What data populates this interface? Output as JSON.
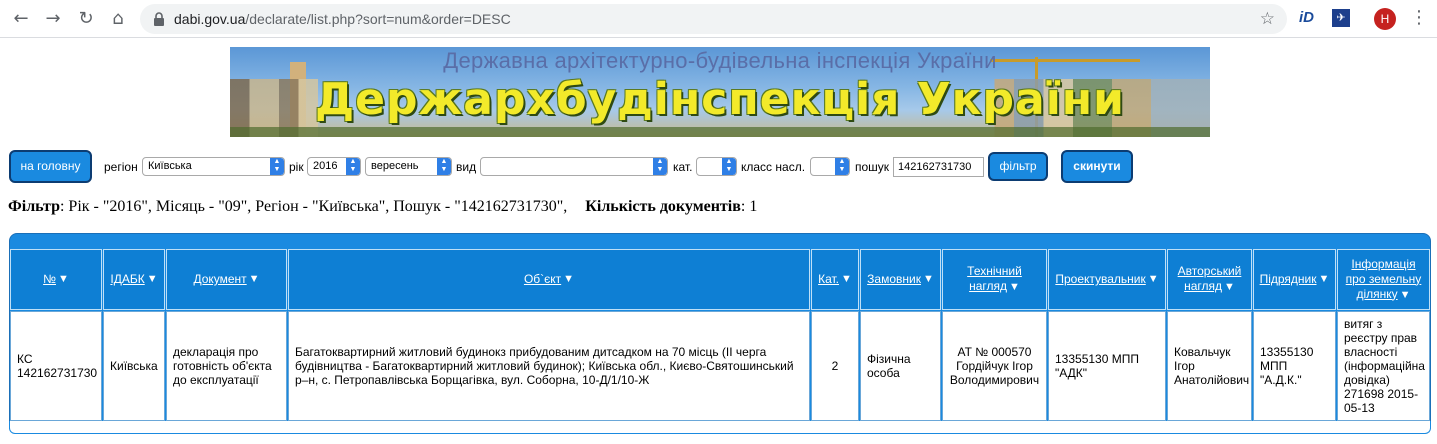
{
  "browser": {
    "url_host": "dabi.gov.ua",
    "url_path": "/declarate/list.php?sort=num&order=DESC",
    "profile_initial": "Н",
    "ext1_label": "iD",
    "ext2_label": "✈"
  },
  "banner": {
    "subtitle": "Державна архітектурно-будівельна інспекція України",
    "title": "Держархбудінспекція України"
  },
  "filters": {
    "home_button": "на головну",
    "region_label": "регіон",
    "region_value": "Київська",
    "year_label": "рік",
    "year_value": "2016",
    "month_value": "вересень",
    "type_label": "вид",
    "type_value": "",
    "cat_label": "кат.",
    "cat_value": "",
    "class_label": "класс насл.",
    "class_value": "",
    "search_label": "пошук",
    "search_value": "142162731730",
    "filter_button": "фільтр",
    "reset_button": "скинути"
  },
  "summary": {
    "filter_label": "Фільтр",
    "filter_text": ": Рік - \"2016\", Місяць - \"09\", Регіон - \"Київська\", Пошук - \"142162731730\",",
    "count_label": "Кількість документів",
    "count_value": ": 1"
  },
  "table": {
    "headers": [
      "№",
      "ІДАБК",
      "Документ",
      "Об`єкт",
      "Кат.",
      "Замовник",
      "Технічний нагляд",
      "Проектувальник",
      "Авторський нагляд",
      "Підрядник",
      "Інформація про земельну ділянку"
    ],
    "row": [
      "КС 142162731730",
      "Київська",
      "декларація про готовність об'єкта до експлуатації",
      "Багатоквартирний житловий будинокз прибудованим дитсадком на 70 місць (ІІ черга будівництва - Багатоквартирний житловий будинок); Київська обл., Києво-Святошинський р–н, с. Петропавлівська Борщагівка, вул. Соборна, 10-Д/1/10-Ж",
      "2",
      "Фізична особа",
      "АТ № 000570 Гордійчук Ігор Володимирович",
      "13355130 МПП \"АДК\"",
      "Ковальчук Ігор Анатолійович",
      "13355130 МПП \"А.Д.К.\"",
      "витяг з реєстру прав власності (інформаційна довідка) 271698 2015-05-13"
    ]
  }
}
